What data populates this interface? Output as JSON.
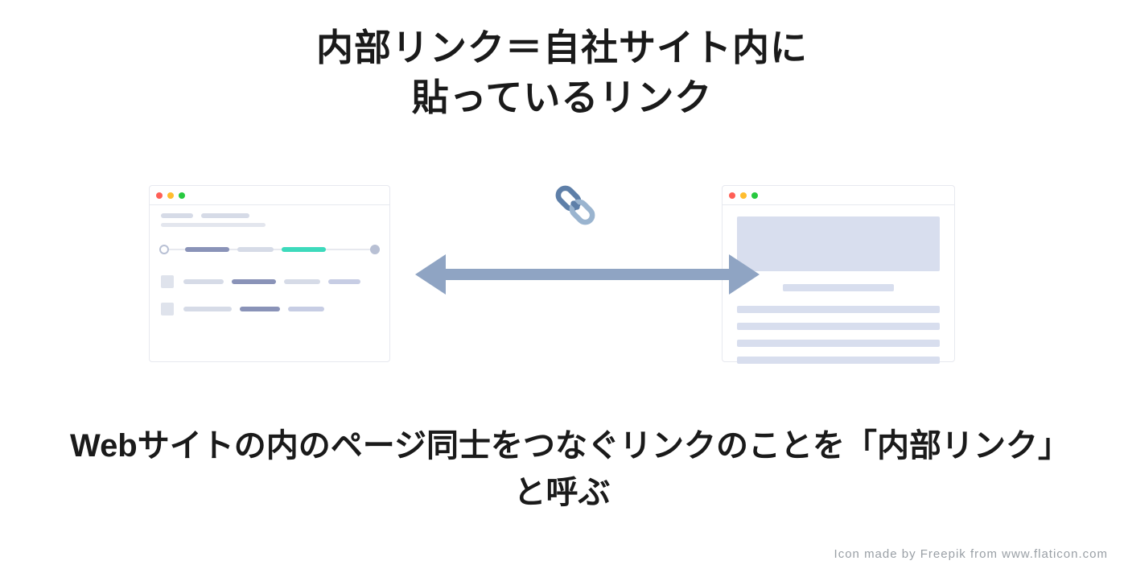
{
  "title_line1": "内部リンク＝自社サイト内に",
  "title_line2": "貼っているリンク",
  "subtitle": "Webサイトの内のページ同士をつなぐリンクのことを「内部リンク」と呼ぶ",
  "credit": "Icon made by Freepik from www.flaticon.com",
  "icons": {
    "link": "link-icon",
    "arrow": "double-arrow-icon",
    "window_left": "browser-window-left",
    "window_right": "browser-window-right"
  },
  "colors": {
    "arrow": "#8fa4c3",
    "link_primary": "#5e7fa8",
    "link_accent": "#9ab4cf",
    "placeholder": "#d8deee"
  }
}
